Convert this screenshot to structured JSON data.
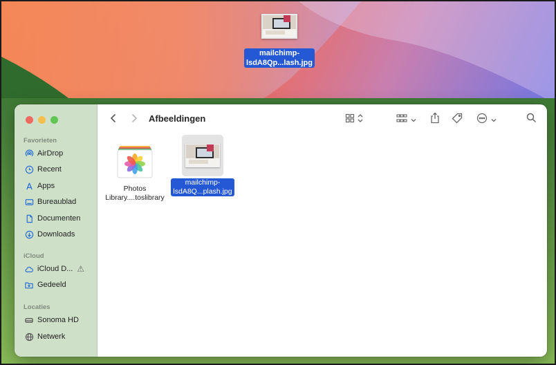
{
  "desktop": {
    "file": {
      "label_line1": "mailchimp-",
      "label_line2": "lsdA8Qp...lash.jpg",
      "icon": "image-thumbnail-icon"
    }
  },
  "window": {
    "title": "Afbeeldingen",
    "sidebar": {
      "sections": [
        {
          "header": "Favorieten",
          "items": [
            {
              "label": "AirDrop",
              "icon": "airdrop-icon"
            },
            {
              "label": "Recent",
              "icon": "clock-icon"
            },
            {
              "label": "Apps",
              "icon": "apps-icon"
            },
            {
              "label": "Bureaublad",
              "icon": "desktop-icon"
            },
            {
              "label": "Documenten",
              "icon": "document-icon"
            },
            {
              "label": "Downloads",
              "icon": "downloads-icon"
            }
          ]
        },
        {
          "header": "iCloud",
          "items": [
            {
              "label": "iCloud D...",
              "icon": "cloud-icon"
            },
            {
              "label": "Gedeeld",
              "icon": "shared-folder-icon"
            }
          ]
        },
        {
          "header": "Locaties",
          "items": [
            {
              "label": "Sonoma HD",
              "icon": "disk-icon"
            },
            {
              "label": "Netwerk",
              "icon": "network-icon"
            }
          ]
        }
      ]
    },
    "files": [
      {
        "label_line1": "Photos",
        "label_line2": "Library....toslibrary",
        "icon": "photos-library-icon",
        "selected": false
      },
      {
        "label_line1": "mailchimp-",
        "label_line2": "lsdA8Q...plash.jpg",
        "icon": "image-thumbnail-icon",
        "selected": true
      }
    ]
  },
  "colors": {
    "selection": "#2458d4",
    "sidebar": "#cfe0c9",
    "accent": "#2a6fd6"
  }
}
